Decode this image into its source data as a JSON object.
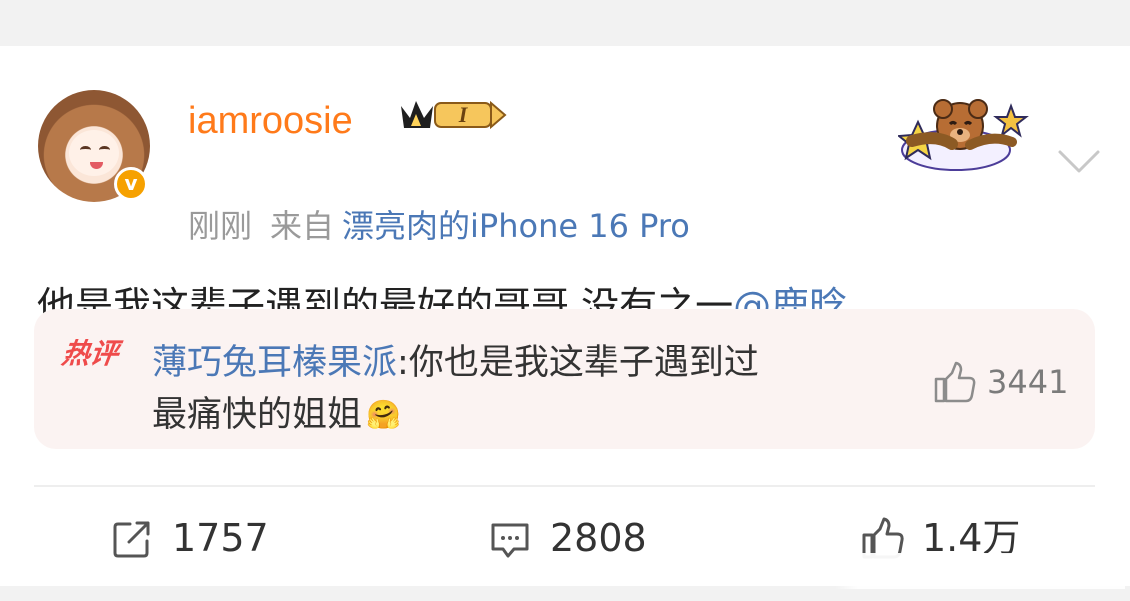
{
  "post": {
    "username": "iamroosie",
    "time": "刚刚",
    "from_label": "来自",
    "device": "漂亮肉的iPhone 16 Pro",
    "text": "他是我这辈子遇到的最好的哥哥 没有之一",
    "mention": "@鹿晗",
    "badge_text": "I"
  },
  "hot_comment": {
    "tag": "热评",
    "author": "薄巧兔耳榛果派",
    "separator": ":",
    "line1": "你也是我这辈子遇到过",
    "line2": "最痛快的姐姐",
    "emoji": "🤗",
    "likes": "3441"
  },
  "actions": {
    "repost_count": "1757",
    "comment_count": "2808",
    "like_count": "1.4万"
  },
  "icons": {
    "verified": "v-icon",
    "crown": "crown-icon",
    "more": "chevron-down-icon",
    "repost": "share-icon",
    "comment": "comment-icon",
    "like": "thumb-up-icon"
  },
  "colors": {
    "username": "#ff7a1a",
    "link": "#4b78b6",
    "hot_tag": "#ef4b4b",
    "comment_background": "#fbf3f2"
  }
}
